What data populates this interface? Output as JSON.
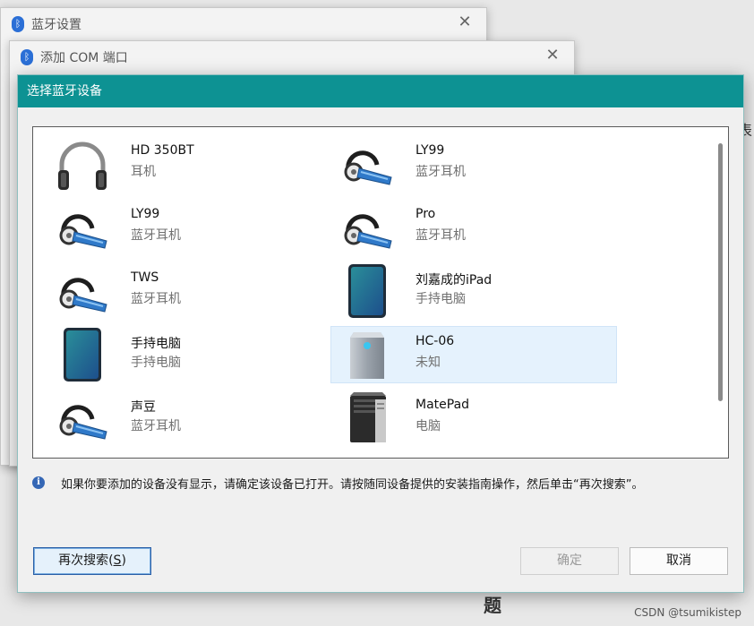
{
  "background_windows": [
    {
      "title": "蓝牙设置",
      "close": "✕"
    },
    {
      "title": "添加 COM 端口",
      "close": "✕"
    }
  ],
  "background_peek": {
    "right_char": "表",
    "bottom_char": "题"
  },
  "dialog": {
    "title": "选择蓝牙设备",
    "devices": [
      {
        "name": "HD 350BT",
        "type": "耳机",
        "icon": "headphones-icon"
      },
      {
        "name": "LY99",
        "type": "蓝牙耳机",
        "icon": "headset-icon"
      },
      {
        "name": "LY99",
        "type": "蓝牙耳机",
        "icon": "headset-icon"
      },
      {
        "name": "Pro",
        "type": "蓝牙耳机",
        "icon": "headset-icon"
      },
      {
        "name": "TWS",
        "type": "蓝牙耳机",
        "icon": "headset-icon"
      },
      {
        "name": "刘嘉成的iPad",
        "type": "手持电脑",
        "icon": "tablet-icon"
      },
      {
        "name": "手持电脑",
        "type": "手持电脑",
        "icon": "tablet-icon"
      },
      {
        "name": "HC-06",
        "type": "未知",
        "icon": "unknown-device-icon",
        "selected": true
      },
      {
        "name": "声豆",
        "type": "蓝牙耳机",
        "icon": "headset-icon"
      },
      {
        "name": "MatePad",
        "type": "电脑",
        "icon": "computer-icon"
      }
    ],
    "info_text": "如果你要添加的设备没有显示，请确定该设备已打开。请按随同设备提供的安装指南操作，然后单击“再次搜索”。",
    "buttons": {
      "research": "再次搜索(",
      "research_key": "S",
      "research_end": ")",
      "ok": "确定",
      "cancel": "取消"
    }
  },
  "watermark": "CSDN @tsumikistep",
  "colors": {
    "titlebar": "#0d9293",
    "selection": "#e5f2fd",
    "bluetooth": "#2b6fd6"
  }
}
